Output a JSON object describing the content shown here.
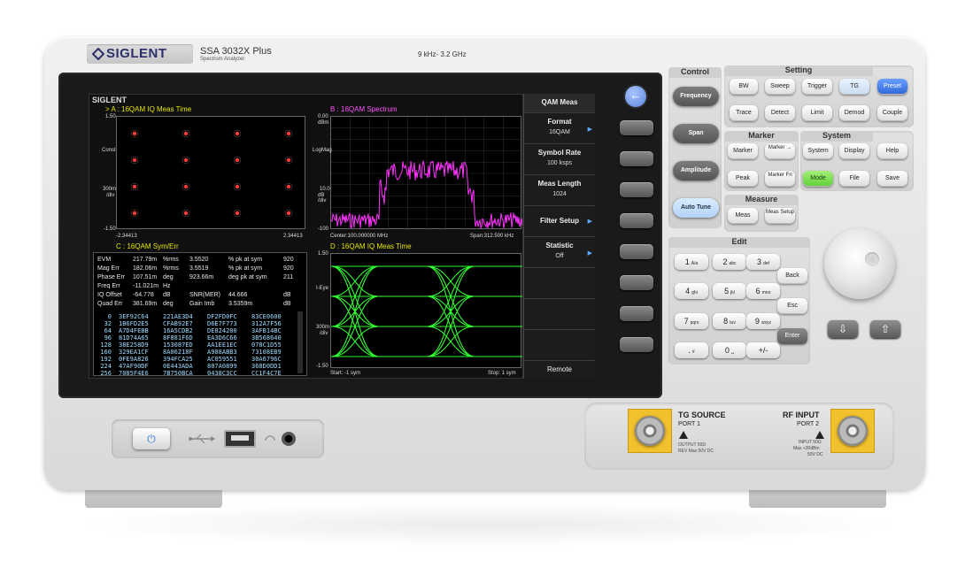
{
  "header": {
    "brand": "SIGLENT",
    "model": "SSA 3032X Plus",
    "model_sub": "Spectrum  Analyzer",
    "freq_range": "9 kHz- 3.2 GHz"
  },
  "screen": {
    "brand": "SIGLENT",
    "window_a": {
      "title": "> A : 16QAM  IQ Meas Time",
      "y_top": "1.50",
      "y_label": "Const",
      "y_mid": "300m",
      "y_mid_unit": "/div",
      "y_bottom": "-1.50",
      "x_left": "-2.34413",
      "x_right": "2.34413"
    },
    "window_b": {
      "title": "B : 16QAM  Spectrum",
      "y_top": "0.00",
      "y_top_unit": "dBm",
      "y_label": "LogMag",
      "y_mid": "10.0",
      "y_mid_unit": "dB /div",
      "y_bottom": "-100",
      "x_left": "Center:100.000000 MHz",
      "x_right": "Span:312.500 kHz"
    },
    "window_c": {
      "title": "C : 16QAM  Sym/Err",
      "metrics": [
        [
          "EVM",
          "217.79m",
          "%rms",
          "3.5520",
          "% pk at sym",
          "920"
        ],
        [
          "Mag Err",
          "182.06m",
          "%rms",
          "3.5519",
          "% pk at sym",
          "920"
        ],
        [
          "Phase Err",
          "107.51m",
          "deg",
          "923.66m",
          "deg pk at sym",
          "211"
        ],
        [
          "Freq Err",
          "-11.021m",
          "Hz",
          "",
          "",
          ""
        ],
        [
          "IQ Offset",
          "-64.778",
          "dB",
          "SNR(MER)",
          "44.666",
          "dB"
        ],
        [
          "Quad Err",
          "381.69m",
          "deg",
          "Gain Imb",
          "3.5359m",
          "dB"
        ]
      ],
      "symbols": [
        [
          "0",
          "3EF92C64",
          "221AE3D4",
          "DF2FD0FC",
          "83CE0600"
        ],
        [
          "32",
          "1B6FD2E5",
          "CFAB92E7",
          "D6E7F773",
          "312A7F56"
        ],
        [
          "64",
          "A7D4FEBB",
          "16A5CDB2",
          "DE824200",
          "3AFB14BC"
        ],
        [
          "96",
          "81D74A65",
          "8F881F6D",
          "EA3D6C66",
          "3B568640"
        ],
        [
          "128",
          "38E258D9",
          "153087ED",
          "AA1EE1EC",
          "078C1D55"
        ],
        [
          "160",
          "329EA1CF",
          "8A06218F",
          "A988ABB3",
          "73108EB9"
        ],
        [
          "192",
          "0FE9A826",
          "394FCA25",
          "AC059551",
          "30A6796C"
        ],
        [
          "224",
          "47AF90DF",
          "0E443ADA",
          "807A0899",
          "368D0DD1"
        ],
        [
          "256",
          "7085F4E6",
          "7B750BCA",
          "0438C3CC",
          "CC1F4C7E"
        ]
      ]
    },
    "window_d": {
      "title": "D : 16QAM  IQ Meas Time",
      "y_top": "1.50",
      "y_label": "I-Eye",
      "y_mid": "300m",
      "y_mid_unit": "/div",
      "y_bottom": "-1.50",
      "x_left": "Start: -1 sym",
      "x_right": "Stop: 1 sym"
    }
  },
  "softmenu": {
    "title": "QAM Meas",
    "items": [
      {
        "label": "Format",
        "value": "16QAM"
      },
      {
        "label": "Symbol Rate",
        "value": "100 ksps"
      },
      {
        "label": "Meas Length",
        "value": "1024"
      },
      {
        "label": "Filter Setup",
        "value": ""
      },
      {
        "label": "Statistic",
        "value": "Off"
      },
      {
        "label": "",
        "value": ""
      },
      {
        "label": "",
        "value": ""
      },
      {
        "label": "",
        "value": ""
      }
    ],
    "bottom": "Remote"
  },
  "panel": {
    "control_title": "Control",
    "control_keys": [
      "Frequency",
      "Span",
      "Amplitude",
      "Auto Tune"
    ],
    "setting_title": "Setting",
    "setting_row1": [
      "BW",
      "Sweep",
      "Trigger",
      "TG",
      "Preset"
    ],
    "setting_row2": [
      "Trace",
      "Detect",
      "Limit",
      "Demod",
      "Couple"
    ],
    "marker_title": "Marker",
    "marker_keys": [
      "Marker",
      "Marker →",
      "Peak",
      "Marker Fn"
    ],
    "system_title": "System",
    "system_keys": [
      "System",
      "Display",
      "Help",
      "Mode",
      "File",
      "Save"
    ],
    "measure_title": "Measure",
    "measure_keys": [
      "Meas",
      "Meas Setup"
    ],
    "edit_title": "Edit",
    "numpad": [
      {
        "d": "1",
        "s": "A/a"
      },
      {
        "d": "2",
        "s": "abc"
      },
      {
        "d": "3",
        "s": "def"
      },
      {
        "d": "4",
        "s": "ghi"
      },
      {
        "d": "5",
        "s": "jkl"
      },
      {
        "d": "6",
        "s": "mno"
      },
      {
        "d": "7",
        "s": "pqrs"
      },
      {
        "d": "8",
        "s": "tuv"
      },
      {
        "d": "9",
        "s": "wxyz"
      },
      {
        "d": ".",
        "s": "#"
      },
      {
        "d": "0",
        "s": "␣"
      },
      {
        "d": "+/-",
        "s": ""
      }
    ],
    "edit_keys": [
      "Back",
      "Esc",
      "Enter"
    ]
  },
  "ports": {
    "tg_title": "TG SOURCE",
    "tg_port": "PORT 1",
    "tg_spec1": "OUTPUT 50Ω",
    "tg_spec2": "REV Max 50V DC",
    "rf_title": "RF INPUT",
    "rf_port": "PORT 2",
    "rf_spec1": "INPUT 50Ω",
    "rf_spec2": "Max +30dBm",
    "rf_spec3": "50V DC"
  },
  "colors": {
    "constellation": "#ff3b3b",
    "spectrum": "#ff33ff",
    "eye": "#33ff33",
    "window_title": "#e6e600",
    "accent_blue": "#2e66d8"
  }
}
